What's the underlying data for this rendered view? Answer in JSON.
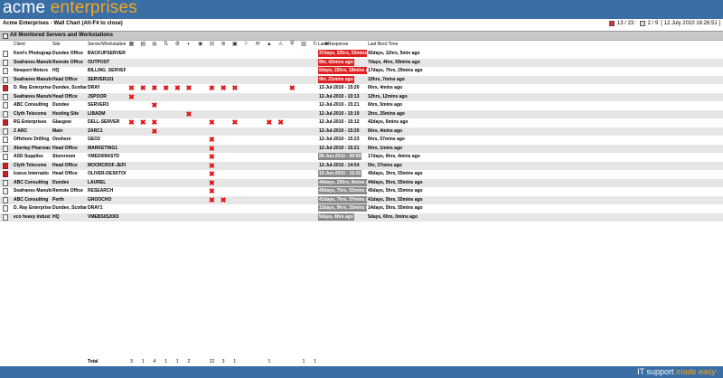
{
  "brand": {
    "part1": "acme ",
    "part2": "enterprises"
  },
  "subbar": {
    "title": "Acme Enterprises - Wall Chart (Alt-F4 to close)",
    "count1": "13 / 23 :",
    "count2": "2 / 9",
    "datetime": "[ 12 July 2010 16:26:51 ]"
  },
  "section": {
    "title": "All Monitored Servers and Workstations"
  },
  "columns": {
    "client": "Client",
    "site": "Site",
    "server": "Server/Workstation",
    "response": "Last Response",
    "boot": "Last Boot Time"
  },
  "header_icons": [
    "cpu-icon",
    "memory-icon",
    "disk-icon",
    "network-icon",
    "process-icon",
    "service-icon",
    "web-icon",
    "printer-icon",
    "antivirus-icon",
    "backup-icon",
    "event-icon",
    "mail-icon",
    "alert-icon",
    "warning-icon",
    "shield-icon",
    "database-icon",
    "update-icon",
    "user-icon"
  ],
  "rows": [
    {
      "client": "Kent's Photograph",
      "site": "Dundee Office",
      "server": "BACKUPSERVER",
      "response": "37days, 22hrs, 53mins",
      "resp_style": "red",
      "boot": "42days, 11hrs, 5min ago",
      "x": [],
      "icon": "plain"
    },
    {
      "client": "Seafranes Manufa",
      "site": "Remote Office",
      "server": "OUTPOST",
      "response": "9hr, 42mins ago",
      "resp_style": "red",
      "boot": "7days, 4hrs, 59mins ago",
      "x": [],
      "icon": "plain"
    },
    {
      "client": "Newport Motors",
      "site": "HQ",
      "server": "BILLING_SERVER",
      "response": "6days, 22hrs, 18mins a",
      "resp_style": "red",
      "boot": "17days, 7hrs, 29mins ago",
      "x": [],
      "icon": "plain"
    },
    {
      "client": "Seafranes Manufa",
      "site": "Head Office",
      "server": "SERVER101",
      "response": "9hr, 21mins ago",
      "resp_style": "red",
      "boot": "10hrs, 7mins ago",
      "x": [],
      "icon": "plain"
    },
    {
      "client": "D. Ray Enterprise",
      "site": "Dundee, Scotland",
      "server": "DRAY",
      "response": "12-Jul-2010 - 15:20",
      "resp_style": "plain",
      "boot": "6hrs, 4mins ago",
      "x": [
        0,
        1,
        2,
        3,
        4,
        5,
        7,
        8,
        9,
        14
      ],
      "icon": "red"
    },
    {
      "client": "Seafranes Manufa",
      "site": "Head Office",
      "server": "JSPOOR",
      "response": "12-Jul-2010 - 10:13",
      "resp_style": "plain",
      "boot": "12hrs, 12mins ago",
      "x": [
        0
      ],
      "icon": "plain"
    },
    {
      "client": "ABC Consulting",
      "site": "Dundee",
      "server": "SERVER3",
      "response": "12-Jul-2010 - 15:21",
      "resp_style": "plain",
      "boot": "6hrs, 5mins ago",
      "x": [
        2
      ],
      "icon": "plain"
    },
    {
      "client": "Clyth Telecoms",
      "site": "Hosting Site",
      "server": "LIBADM",
      "response": "12-Jul-2010 - 15:19",
      "resp_style": "plain",
      "boot": "2hrs, 25mins ago",
      "x": [
        5
      ],
      "icon": "plain"
    },
    {
      "client": "RG Enterprises",
      "site": "Glasgow",
      "server": "DELL-SERVER",
      "response": "12-Jul-2010 - 15:12",
      "resp_style": "plain",
      "boot": "42days, 6mins ago",
      "x": [
        0,
        1,
        2,
        7,
        9,
        12,
        13
      ],
      "icon": "red"
    },
    {
      "client": "Z ARC",
      "site": "Main",
      "server": "ZARC1",
      "response": "12-Jul-2010 - 15:20",
      "resp_style": "plain",
      "boot": "6hrs, 4mins ago",
      "x": [
        2
      ],
      "icon": "plain"
    },
    {
      "client": "Offshore Drilling",
      "site": "Onshore",
      "server": "GEO2",
      "response": "12-Jul-2010 - 15:23",
      "resp_style": "plain",
      "boot": "6hrs, 57mins ago",
      "x": [
        7
      ],
      "icon": "plain"
    },
    {
      "client": "Abertay Pharmac",
      "site": "Head Office",
      "server": "MARKETING1",
      "response": "12-Jul-2010 - 15:21",
      "resp_style": "plain",
      "boot": "6hrs, 1mins ago",
      "x": [
        7
      ],
      "icon": "plain"
    },
    {
      "client": "ASD Supplies",
      "site": "Storeroom",
      "server": "VMEDI09ASTD",
      "response": "26-Jun-2010 - 09:59",
      "resp_style": "grey",
      "boot": "17days, 6hrs, 4mins ago",
      "x": [
        7
      ],
      "icon": "plain"
    },
    {
      "client": "Clyth Telecoms",
      "site": "Head Office",
      "server": "MOORCROF-JEFF",
      "response": "12-Jul-2010 - 14:54",
      "resp_style": "plain",
      "boot": "5hr, 37mins ago",
      "x": [
        7
      ],
      "icon": "red"
    },
    {
      "client": "Icarus Internatio",
      "site": "Head Office",
      "server": "OLIVER-DESKTOP",
      "response": "15-Jun-2010 - 15:32",
      "resp_style": "grey",
      "boot": "45days, 3hrs, 55mins ago",
      "x": [
        7
      ],
      "icon": "red"
    },
    {
      "client": "ABC Consulting",
      "site": "Dundee",
      "server": "LAUREL",
      "response": "44days, 22hrs, 8mins a",
      "resp_style": "grey",
      "boot": "44days, 5hrs, 55mins ago",
      "x": [
        7
      ],
      "icon": "plain"
    },
    {
      "client": "Seafranes Manufa",
      "site": "Remote Office",
      "server": "RESEARCH",
      "response": "45days, 7hrs, 52mins a",
      "resp_style": "grey",
      "boot": "45days, 5hrs, 55mins ago",
      "x": [
        7
      ],
      "icon": "plain"
    },
    {
      "client": "ABC Consulting",
      "site": "Perth",
      "server": "GROOCHO",
      "response": "41days, 7hrs, 37mins a",
      "resp_style": "grey",
      "boot": "41days, 5hrs, 55mins ago",
      "x": [
        7,
        8
      ],
      "icon": "plain"
    },
    {
      "client": "D. Ray Enterprise",
      "site": "Dundee, Scotland",
      "server": "DRAY1",
      "response": "13days, 9hrs, 25mins a",
      "resp_style": "grey",
      "boot": "14days, 5hrs, 55mins ago",
      "x": [],
      "icon": "plain"
    },
    {
      "client": "eco heavy indust",
      "site": "HQ",
      "server": "VMEBS052003",
      "response": "5days, 6hrs ago",
      "resp_style": "grey",
      "boot": "5days, 6hrs, 0mins ago",
      "x": [],
      "icon": "plain"
    }
  ],
  "totals": {
    "label": "Total",
    "values": [
      "3",
      "1",
      "4",
      "1",
      "1",
      "2",
      "",
      "12",
      "3",
      "1",
      "",
      "",
      "1",
      "",
      "",
      "1",
      "1",
      ""
    ]
  },
  "footer": {
    "part1": "IT support ",
    "part2": "made easy"
  }
}
